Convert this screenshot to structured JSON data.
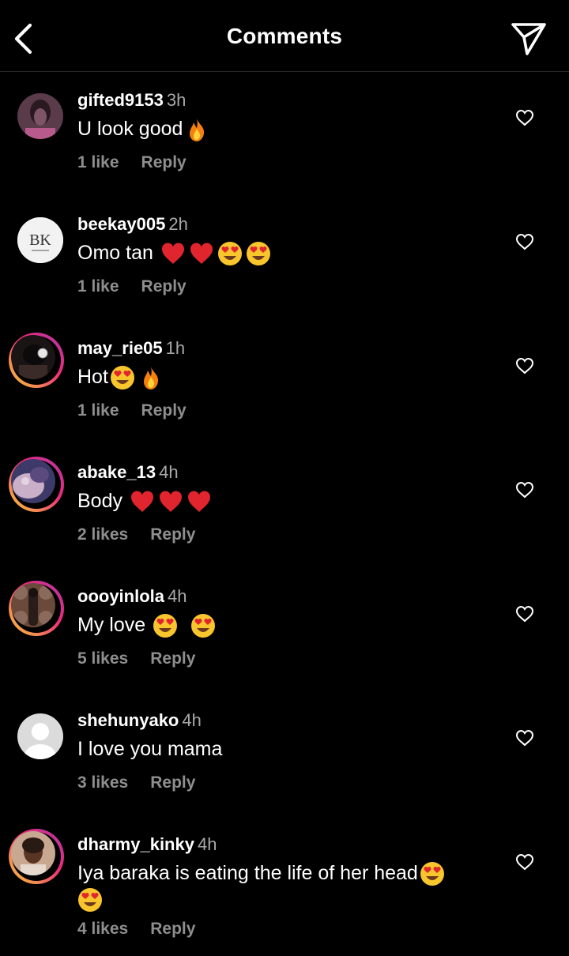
{
  "header": {
    "title": "Comments",
    "back_icon": "chevron-left-icon",
    "send_icon": "paper-plane-icon"
  },
  "colors": {
    "background": "#000000",
    "muted": "#a8a8a8",
    "story_ring_start": "#f9ce34",
    "story_ring_end": "#ee2a7b"
  },
  "comments": [
    {
      "username": "gifted9153",
      "time": "3h",
      "text": "U look good",
      "emojis": [
        "fire"
      ],
      "likes": "1 like",
      "reply": "Reply",
      "story_ring": false
    },
    {
      "username": "beekay005",
      "time": "2h",
      "text": "Omo tan ",
      "emojis": [
        "red-heart",
        "red-heart",
        "heart-eyes",
        "heart-eyes"
      ],
      "likes": "1 like",
      "reply": "Reply",
      "story_ring": false,
      "avatar_text": "BK"
    },
    {
      "username": "may_rie05",
      "time": "1h",
      "text": "Hot",
      "emojis": [
        "heart-eyes",
        "fire"
      ],
      "likes": "1 like",
      "reply": "Reply",
      "story_ring": true
    },
    {
      "username": "abake_13",
      "time": "4h",
      "text": "Body ",
      "emojis": [
        "red-heart",
        "red-heart",
        "red-heart"
      ],
      "likes": "2 likes",
      "reply": "Reply",
      "story_ring": true
    },
    {
      "username": "oooyinlola",
      "time": "4h",
      "text": "My love ",
      "emojis": [
        "heart-eyes",
        "heart-eyes"
      ],
      "likes": "5 likes",
      "reply": "Reply",
      "story_ring": true
    },
    {
      "username": "shehunyako",
      "time": "4h",
      "text": "I love you mama",
      "emojis": [],
      "likes": "3 likes",
      "reply": "Reply",
      "story_ring": false
    },
    {
      "username": "dharmy_kinky",
      "time": "4h",
      "text": "Iya baraka is eating the life of her head",
      "emojis": [
        "heart-eyes",
        "heart-eyes"
      ],
      "likes": "4 likes",
      "reply": "Reply",
      "story_ring": true
    }
  ]
}
